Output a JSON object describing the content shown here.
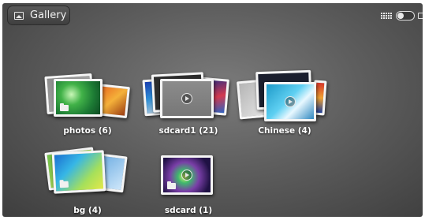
{
  "app": {
    "title": "Gallery",
    "title_icon": "gallery-icon",
    "toolbar_icons": [
      "grid-view-icon",
      "view-toggle",
      "slideshow-icon"
    ]
  },
  "albums": [
    {
      "label": "photos  (6)",
      "type": "images"
    },
    {
      "label": "sdcard1  (21)",
      "type": "videos"
    },
    {
      "label": "Chinese  (4)",
      "type": "videos"
    },
    {
      "label": "bg  (4)",
      "type": "images"
    },
    {
      "label": "sdcard  (1)",
      "type": "videos"
    }
  ],
  "colors": {
    "background": "#5e5e5e",
    "label_text": "#ffffff",
    "photo_border": "#f5f5f5"
  }
}
